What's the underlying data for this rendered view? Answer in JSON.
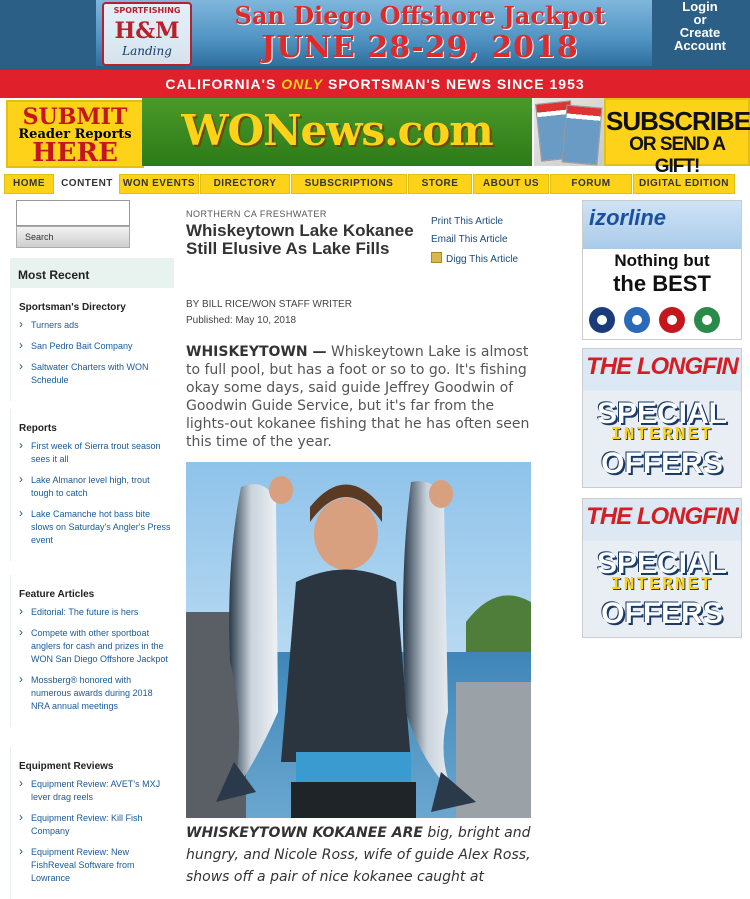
{
  "top_ad": {
    "logo_line1": "SPORTFISHING",
    "logo_line2": "H&M",
    "logo_line3": "Landing",
    "title": "San Diego Offshore Jackpot",
    "dates": "JUNE 28-29, 2018"
  },
  "login": {
    "line1": "Login",
    "line2": "or",
    "line3": "Create",
    "line4": "Account"
  },
  "tagline": {
    "before": "CALIFORNIA'S ",
    "emphasis": "ONLY",
    "after": " SPORTSMAN'S NEWS SINCE 1953"
  },
  "submit": {
    "line1": "SUBMIT",
    "line2": "Reader Reports",
    "line3": "HERE"
  },
  "site_logo": "WONews.com",
  "subscribe": {
    "line1": "SUBSCRIBE",
    "line2": "OR SEND A GIFT!"
  },
  "nav": [
    "HOME",
    "CONTENT",
    "WON EVENTS",
    "DIRECTORY",
    "SUBSCRIPTIONS",
    "STORE",
    "ABOUT US",
    "FORUM",
    "DIGITAL EDITION"
  ],
  "search": {
    "value": "",
    "button": "Search"
  },
  "sidebar": {
    "heading": "Most Recent",
    "sections": [
      {
        "title": "Sportsman's Directory",
        "links": [
          "Turners ads",
          "San Pedro Bait Company",
          "Saltwater Charters with WON Schedule"
        ]
      },
      {
        "title": "Reports",
        "links": [
          "First week of Sierra trout season sees it all",
          "Lake Almanor level high, trout tough to catch",
          "Lake Camanche hot bass bite slows on Saturday's Angler's Press event"
        ]
      },
      {
        "title": "Feature Articles",
        "links": [
          "Editorial: The future is hers",
          "Compete with other sportboat anglers for cash and prizes in the WON San Diego Offshore Jackpot",
          "Mossberg® honored with numerous awards during 2018 NRA annual meetings"
        ]
      },
      {
        "title": "Equipment Reviews",
        "links": [
          "Equipment Review: AVET's MXJ lever drag reels",
          "Equipment Review: Kill Fish Company",
          "Equipment Review: New FishReveal Software from Lowrance"
        ]
      }
    ]
  },
  "article": {
    "kicker": "NORTHERN CA FRESHWATER",
    "headline": "Whiskeytown Lake Kokanee Still Elusive As Lake Fills",
    "byline": "BY BILL RICE/WON STAFF WRITER",
    "published": "Published: May 10, 2018",
    "dateline": "WHISKEYTOWN —",
    "lede": " Whiskeytown Lake is almost to full pool, but has a foot or so to go. It's fishing okay some days, said guide Jeffrey Goodwin of Goodwin Guide Service, but it's far from the lights-out kokanee fishing that he has often seen this time of the year.",
    "caption_lead": "WHISKEYTOWN KOKANEE ARE",
    "caption": " big, bright and hungry, and Nicole Ross, wife of guide Alex Ross, shows off a pair of nice kokanee caught at"
  },
  "tools": {
    "print": "Print This Article",
    "email": "Email This Article",
    "digg": "Digg This Article"
  },
  "right_ads": {
    "izorline_brand": "izorline",
    "izorline_tag1": "Nothing but",
    "izorline_tag2": "the BEST",
    "longfin": "THE LONGFIN",
    "special": "SPECIAL",
    "internet": "INTERNET",
    "offers": "OFFERS"
  },
  "colors": {
    "nav_yellow": "#ffd21a",
    "red_bar": "#e0202a",
    "link_blue": "#1a5a9a",
    "logo_green": "#2d7a18"
  }
}
